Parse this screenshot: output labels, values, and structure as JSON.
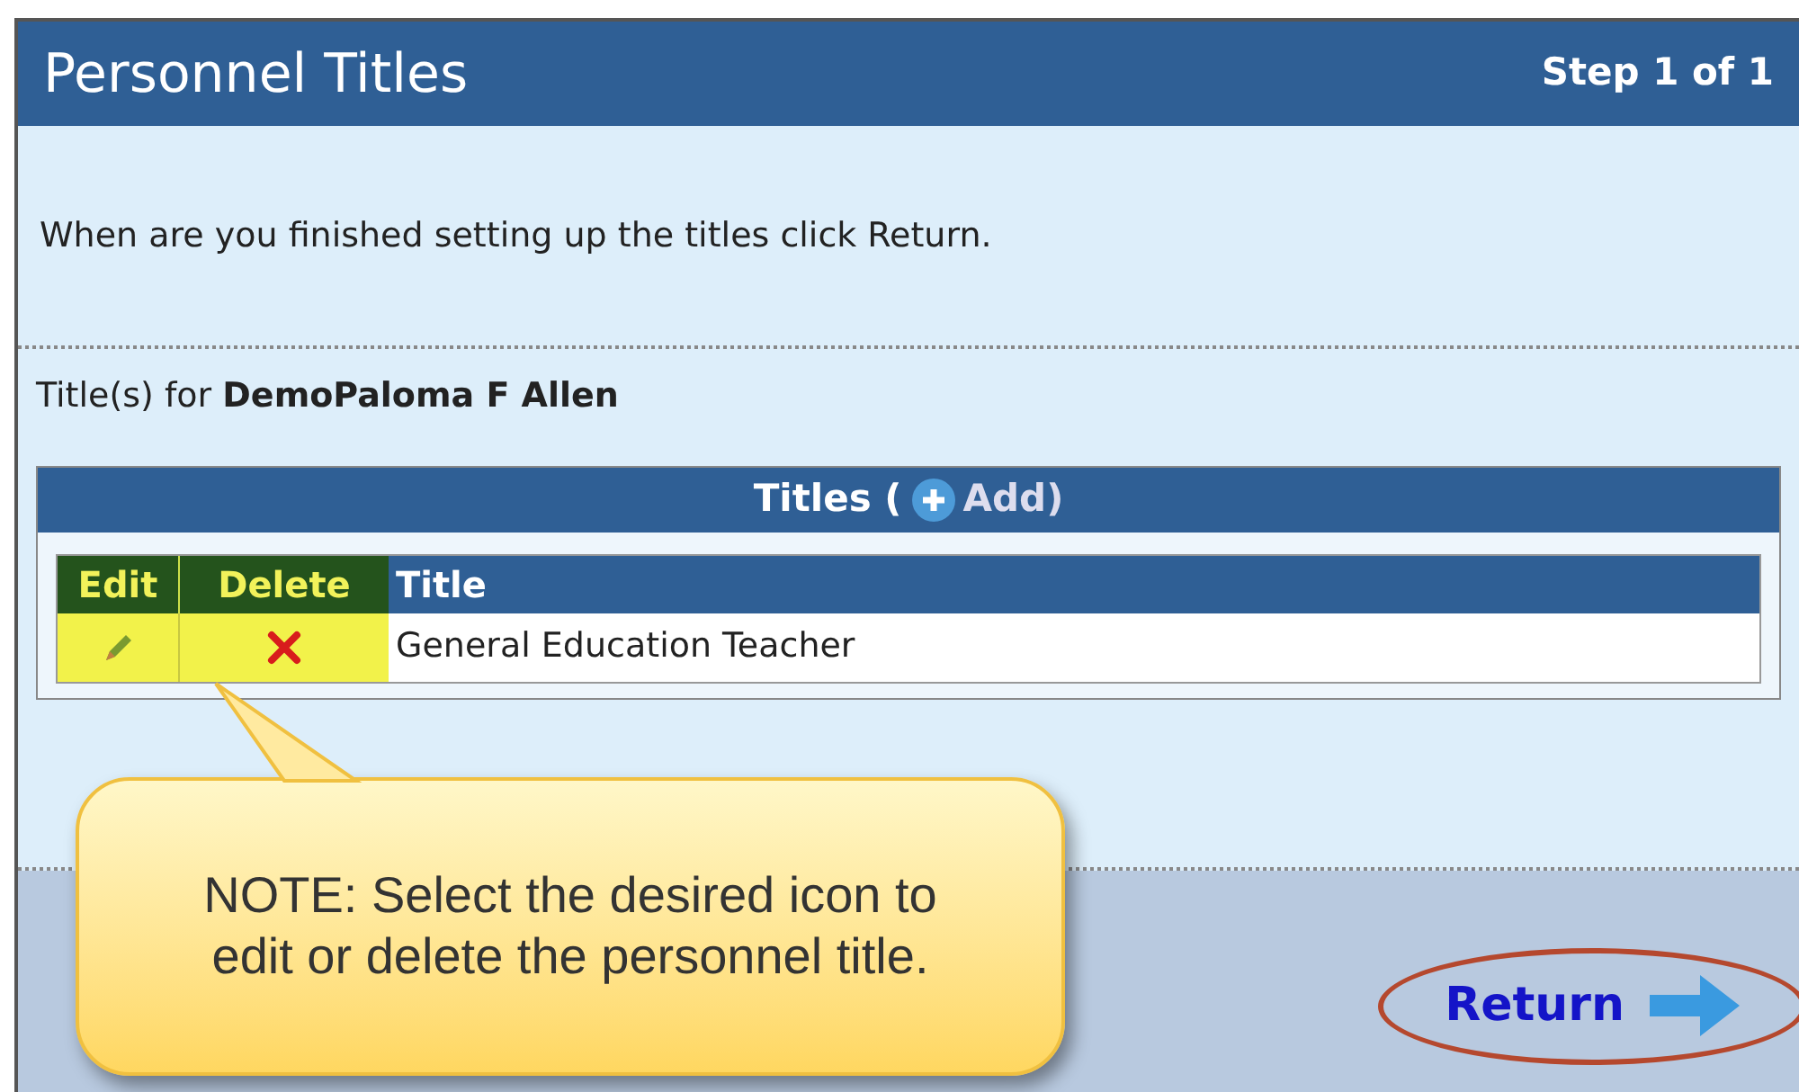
{
  "header": {
    "title": "Personnel Titles",
    "step": "Step 1 of 1"
  },
  "instructions": "When are you finished setting up the titles click Return.",
  "titles_for": "Title(s) for **DemoPaloma F Allen**",
  "table": {
    "caption_before": "Titles (",
    "add_label": "Add)",
    "columns": [
      "Edit",
      "Delete",
      "Title"
    ],
    "rows": [
      {
        "title": "General Education Teacher"
      }
    ]
  },
  "callout": "NOTE: Select the desired icon to edit or delete the personnel title.",
  "return_label": "Return"
}
